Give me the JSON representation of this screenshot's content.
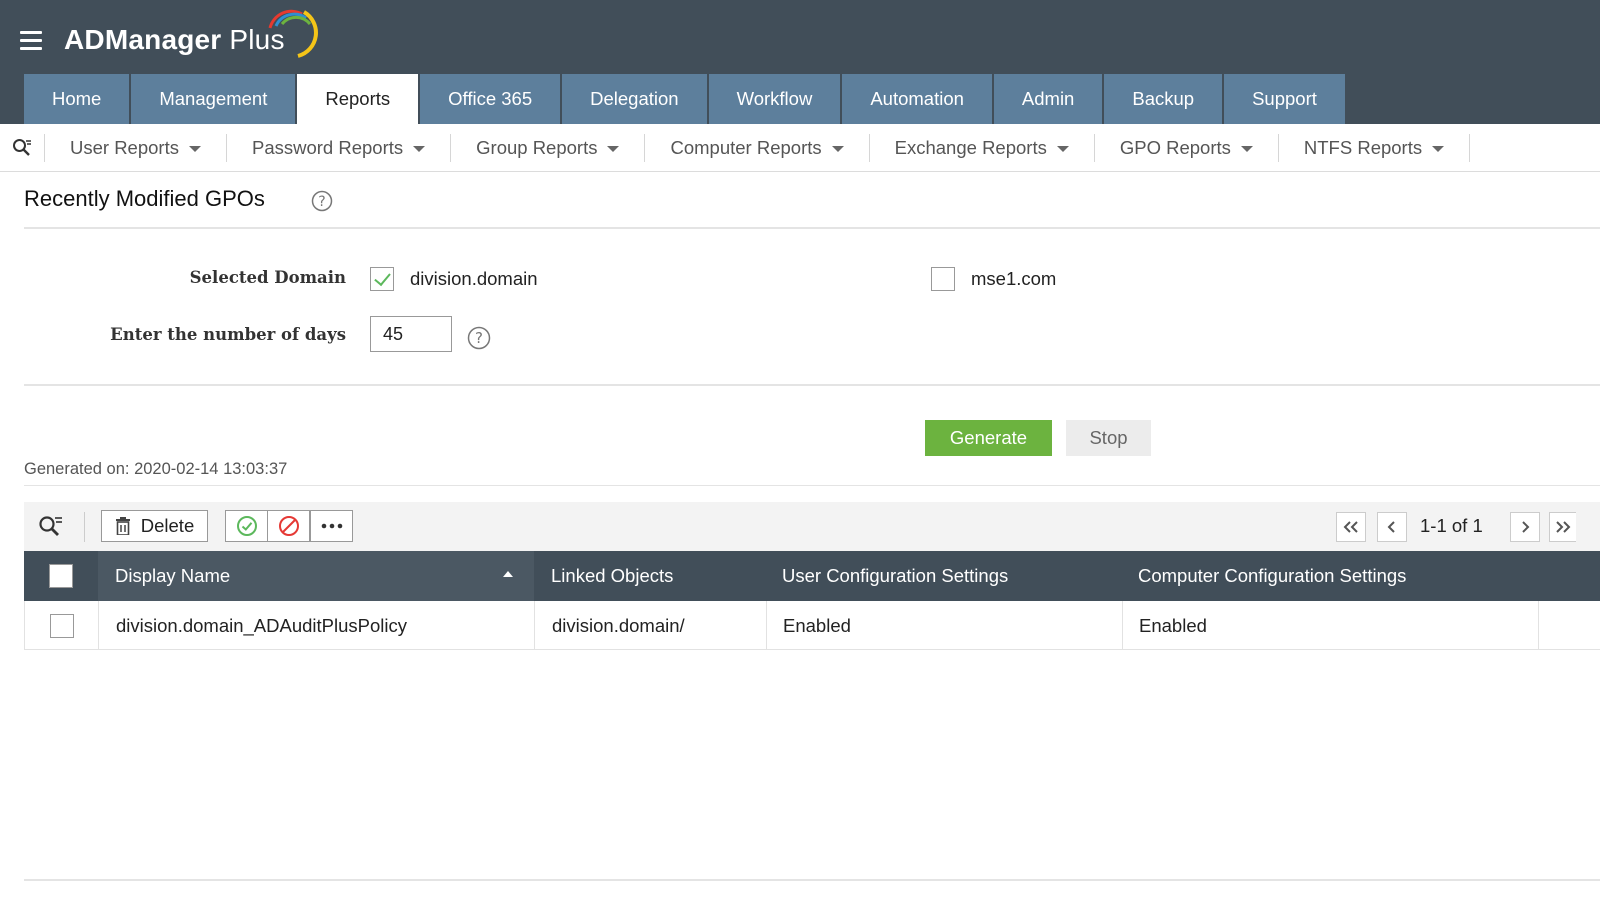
{
  "app": {
    "logo_main": "ADManager",
    "logo_plus": " Plus",
    "brand_arc_colors": [
      "#e63a2f",
      "#2f8fd0",
      "#6cb33f",
      "#f5c518"
    ]
  },
  "header": {
    "tabs": [
      {
        "label": "Home"
      },
      {
        "label": "Management"
      },
      {
        "label": "Reports",
        "active": true
      },
      {
        "label": "Office 365"
      },
      {
        "label": "Delegation"
      },
      {
        "label": "Workflow"
      },
      {
        "label": "Automation"
      },
      {
        "label": "Admin"
      },
      {
        "label": "Backup"
      },
      {
        "label": "Support"
      }
    ]
  },
  "subnav": {
    "items": [
      {
        "label": "User Reports"
      },
      {
        "label": "Password Reports"
      },
      {
        "label": "Group Reports"
      },
      {
        "label": "Computer Reports"
      },
      {
        "label": "Exchange Reports"
      },
      {
        "label": "GPO Reports"
      },
      {
        "label": "NTFS Reports"
      }
    ]
  },
  "page": {
    "title": "Recently Modified GPOs"
  },
  "form": {
    "domain_label": "Selected Domain",
    "domains": [
      {
        "name": "division.domain",
        "checked": true
      },
      {
        "name": "mse1.com",
        "checked": false
      }
    ],
    "days_label": "Enter the number of days",
    "days_value": "45"
  },
  "actions": {
    "generate": "Generate",
    "stop": "Stop"
  },
  "report": {
    "generated_on": "Generated on: 2020-02-14 13:03:37"
  },
  "toolbar": {
    "delete_label": "Delete",
    "pagination": "1-1 of 1"
  },
  "table": {
    "columns": [
      {
        "label": "Display Name",
        "sorted": "asc"
      },
      {
        "label": "Linked Objects"
      },
      {
        "label": "User Configuration Settings"
      },
      {
        "label": "Computer Configuration Settings"
      }
    ],
    "rows": [
      {
        "display_name": "division.domain_ADAuditPlusPolicy",
        "linked_objects": "division.domain/",
        "user_config": "Enabled",
        "computer_config": "Enabled"
      }
    ]
  },
  "colors": {
    "header_bg": "#414e59",
    "tab_bg": "#5d7f9c",
    "generate_bg": "#6cb33f",
    "check_green": "#5cb85c",
    "block_red": "#e53935"
  }
}
